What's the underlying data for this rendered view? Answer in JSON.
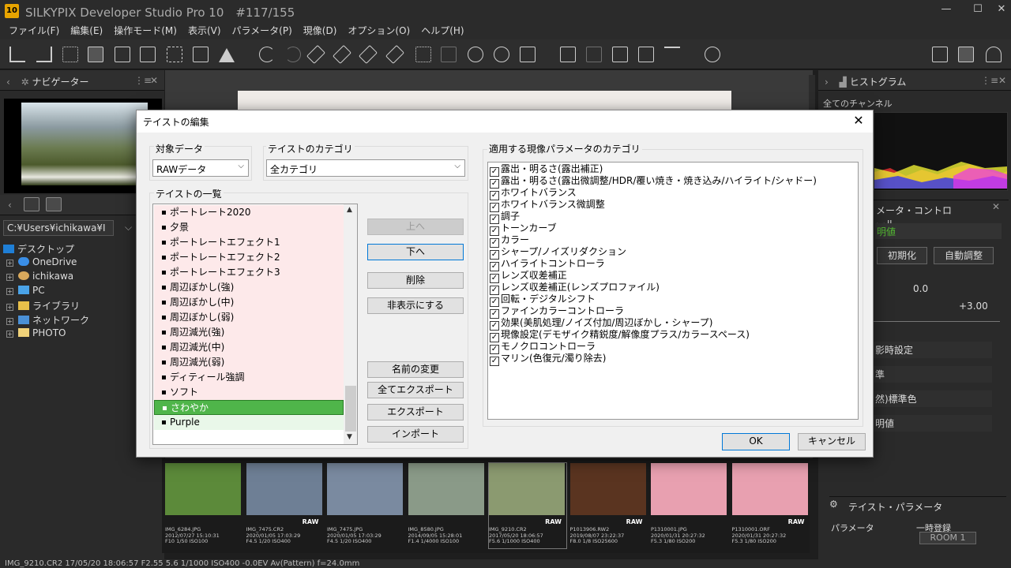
{
  "app": {
    "logo": "10",
    "title": "SILKYPIX Developer Studio Pro 10　#117/155"
  },
  "window": {
    "minimize": "—",
    "maximize": "☐",
    "close": "✕"
  },
  "menu": [
    "ファイル(F)",
    "編集(E)",
    "操作モード(M)",
    "表示(V)",
    "パラメータ(P)",
    "現像(D)",
    "オプション(O)",
    "ヘルプ(H)"
  ],
  "left": {
    "navigator_title": "ナビゲーター",
    "path": "C:¥Users¥ichikawa¥I",
    "tree": [
      "デスクトップ",
      "OneDrive",
      "ichikawa",
      "PC",
      "ライブラリ",
      "ネットワーク",
      "PHOTO"
    ]
  },
  "right": {
    "histogram_title": "ヒストグラム",
    "channel": "全てのチャンネル",
    "control_title": "メータ・コントロール",
    "preset": "明値",
    "init_label": "初期化",
    "auto_label": "自動調整",
    "exposure_value": "0.0",
    "exposure_max": "+3.00",
    "row1": "影時設定",
    "row2": "準",
    "row3": "然)標準色",
    "row4": "明値",
    "taste_param_title": "テイスト・パラメータ",
    "param_label": "パラメータ",
    "temp_reg_label": "一時登録",
    "room_label": "ROOM 1"
  },
  "filmstrip": [
    {
      "name": "IMG_6284.JPG",
      "date": "2012/07/27 15:10:31",
      "exif": "F10 1/50 ISO100",
      "raw": "",
      "color": "#5c8a3a"
    },
    {
      "name": "IMG_7475.CR2",
      "date": "2020/01/05 17:03:29",
      "exif": "F4.5 1/20 ISO400",
      "raw": "RAW",
      "color": "#6e7f95"
    },
    {
      "name": "IMG_7475.JPG",
      "date": "2020/01/05 17:03:29",
      "exif": "F4.5 1/20 ISO400",
      "raw": "",
      "color": "#7a8aa0"
    },
    {
      "name": "IMG_8580.JPG",
      "date": "2014/09/05 15:28:01",
      "exif": "F1.4 1/4000 ISO100",
      "raw": "",
      "color": "#8a9a88"
    },
    {
      "name": "IMG_9210.CR2",
      "date": "2017/05/20 18:06:57",
      "exif": "F5.6 1/1000 ISO400",
      "raw": "RAW",
      "color": "#8b9a70"
    },
    {
      "name": "P1013906.RW2",
      "date": "2019/08/07 23:22:37",
      "exif": "F8.0 1/8 ISO25600",
      "raw": "RAW",
      "color": "#5a3420"
    },
    {
      "name": "P1310001.JPG",
      "date": "2020/01/31 20:27:32",
      "exif": "F5.3 1/80 ISO200",
      "raw": "",
      "color": "#e8a0b0"
    },
    {
      "name": "P1310001.ORF",
      "date": "2020/01/31 20:27:32",
      "exif": "F5.3 1/80 ISO200",
      "raw": "RAW",
      "color": "#e8a0b0"
    }
  ],
  "status": "IMG_9210.CR2 17/05/20 18:06:57 F2.55 5.6 1/1000 ISO400 -0.0EV Av(Pattern) f=24.0mm",
  "dialog": {
    "title": "テイストの編集",
    "close": "✕",
    "target_label": "対象データ",
    "target_value": "RAWデータ",
    "category_label": "テイストのカテゴリ",
    "category_value": "全カテゴリ",
    "list_label": "テイストの一覧",
    "tastes": [
      "ポートレート2020",
      "夕景",
      "ポートレートエフェクト1",
      "ポートレートエフェクト2",
      "ポートレートエフェクト3",
      "周辺ぼかし(強)",
      "周辺ぼかし(中)",
      "周辺ぼかし(弱)",
      "周辺減光(強)",
      "周辺減光(中)",
      "周辺減光(弱)",
      "ディティール強調",
      "ソフト",
      "さわやか",
      "Purple"
    ],
    "selected_index": 13,
    "buttons": {
      "up": "上へ",
      "down": "下へ",
      "delete": "削除",
      "hide": "非表示にする",
      "rename": "名前の変更",
      "export_all": "全てエクスポート",
      "export": "エクスポート",
      "import": "インポート",
      "ok": "OK",
      "cancel": "キャンセル"
    },
    "params_label": "適用する現像パラメータのカテゴリ",
    "params": [
      "露出・明るさ(露出補正)",
      "露出・明るさ(露出微調整/HDR/覆い焼き・焼き込み/ハイライト/シャドー)",
      "ホワイトバランス",
      "ホワイトバランス微調整",
      "調子",
      "トーンカーブ",
      "カラー",
      "シャープ/ノイズリダクション",
      "ハイライトコントローラ",
      "レンズ収差補正",
      "レンズ収差補正(レンズプロファイル)",
      "回転・デジタルシフト",
      "ファインカラーコントローラ",
      "効果(美肌処理/ノイズ付加/周辺ぼかし・シャープ)",
      "現像設定(デモザイク精鋭度/解像度プラス/カラースペース)",
      "モノクロコントローラ",
      "マリン(色復元/濁り除去)"
    ]
  }
}
